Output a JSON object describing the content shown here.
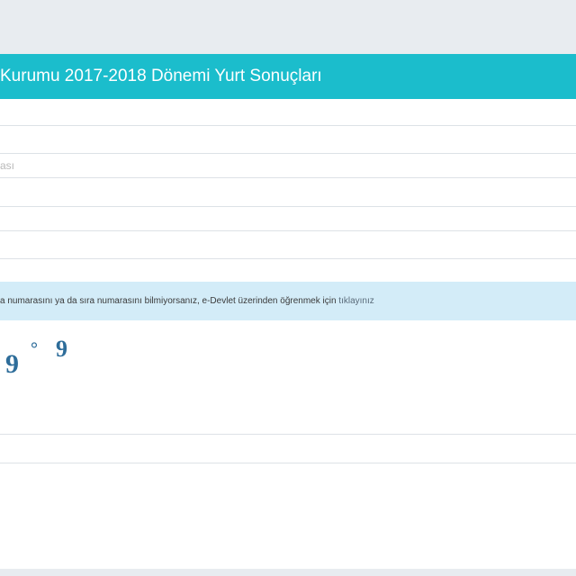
{
  "panel": {
    "title": "Kurumu 2017-2018 Dönemi Yurt Sonuçları"
  },
  "form": {
    "fields": [
      {
        "id": "field-1",
        "value": "",
        "placeholder": ""
      },
      {
        "id": "field-2",
        "value": "",
        "placeholder": "ası"
      },
      {
        "id": "field-3",
        "value": "",
        "placeholder": ""
      },
      {
        "id": "field-4",
        "value": "",
        "placeholder": ""
      },
      {
        "id": "field-5",
        "value": "",
        "placeholder": ""
      },
      {
        "id": "field-6",
        "value": "",
        "placeholder": ""
      }
    ],
    "captcha_input": {
      "value": "",
      "placeholder": ""
    }
  },
  "info": {
    "text": "a numarasını ya da sıra numarasını bilmiyorsanız, e-Devlet üzerinden öğrenmek için ",
    "link_text": "tıklayınız"
  },
  "captcha": {
    "text": "9°9",
    "color": "#2e6d9a"
  },
  "colors": {
    "header": "#1bbdcc",
    "info_bg": "#d3ecf8",
    "page_bg": "#e8ecf0"
  }
}
